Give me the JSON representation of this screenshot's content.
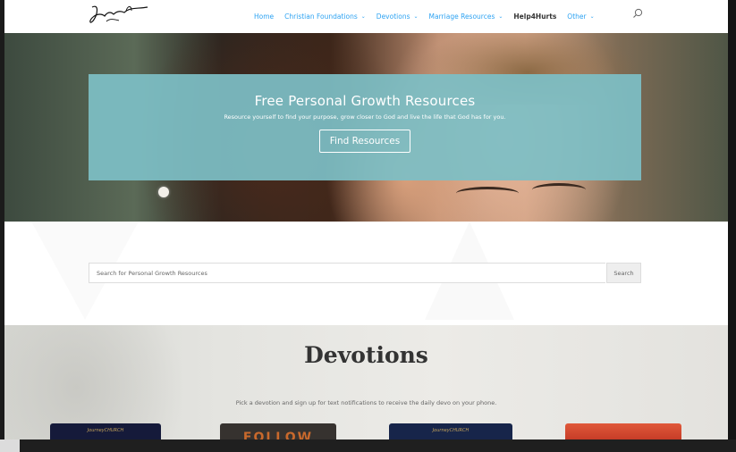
{
  "header": {
    "nav": [
      {
        "label": "Home",
        "dropdown": false
      },
      {
        "label": "Christian Foundations",
        "dropdown": true
      },
      {
        "label": "Devotions",
        "dropdown": true
      },
      {
        "label": "Marriage Resources",
        "dropdown": true
      },
      {
        "label": "Help4Hurts",
        "dropdown": false
      },
      {
        "label": "Other",
        "dropdown": true
      }
    ],
    "search_icon": "search-icon"
  },
  "hero": {
    "title": "Free Personal Growth Resources",
    "subtitle": "Resource yourself to find your purpose, grow closer to God and live the life that God has for you.",
    "button": "Find Resources"
  },
  "search": {
    "placeholder": "Search for Personal Growth Resources",
    "button": "Search"
  },
  "devotions": {
    "title": "Devotions",
    "subtitle": "Pick a devotion and sign up for text notifications to receive the daily devo on your phone.",
    "cards": [
      {
        "text": "JourneyCHURCH"
      },
      {
        "text": "FOLLOW"
      },
      {
        "text": "JourneyCHURCH"
      },
      {
        "text": ""
      }
    ]
  },
  "colors": {
    "accent": "#2ea3f2",
    "hero_box": "#7dbec5",
    "nav_dark": "#333333"
  }
}
